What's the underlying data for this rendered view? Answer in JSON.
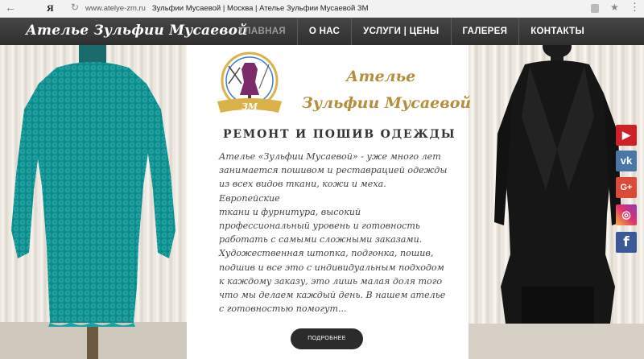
{
  "browser": {
    "back_icon": "←",
    "yandex_label": "Я",
    "refresh_icon": "↻",
    "url_domain": "www.atelye-zm.ru",
    "page_title": "Зульфии Мусаевой | Москва | Ателье Зульфии Мусаевой ЗМ",
    "star_icon": "★",
    "menu_icon": "⋮"
  },
  "site": {
    "brand": "Ателье Зульфии Мусаевой",
    "menu": [
      {
        "label": "ГЛАВНАЯ",
        "active": true
      },
      {
        "label": "О НАС",
        "active": false
      },
      {
        "label": "УСЛУГИ | ЦЕНЫ",
        "active": false
      },
      {
        "label": "ГАЛЕРЕЯ",
        "active": false
      },
      {
        "label": "КОНТАКТЫ",
        "active": false
      }
    ]
  },
  "hero": {
    "logo_monogram": "ЗМ",
    "logo_line1": "Ателье",
    "logo_line2": "Зульфии Мусаевой",
    "tagline": "РЕМОНТ И ПОШИВ ОДЕЖДЫ",
    "description_lines": [
      "Ателье «Зульфии Мусаевой» - уже много лет",
      "занимается пошивом и реставрацией одежды",
      "из всех видов ткани, кожи и меха. Европейские",
      "ткани и фурнитура, высокий",
      "профессиональный уровень и готовность",
      "работать с самыми сложными заказами.",
      "Художественная штопка, подгонка, пошив,",
      "подшив и все это с  индивидуальным подходом",
      "к каждому заказу, это лишь малая доля того",
      "что мы делаем каждый день.   В нашем ателье",
      "с готовностью помогут..."
    ],
    "more_button": "ПОДРОБНЕЕ"
  },
  "social": {
    "youtube": "▶",
    "vk": "vk",
    "google_plus": "G+",
    "instagram": "◎",
    "facebook": "f"
  },
  "colors": {
    "navbar": "#3c3c3c",
    "gold": "#b68d3a",
    "dress_left": "#0f8e90",
    "dress_right": "#1a1a1a"
  }
}
